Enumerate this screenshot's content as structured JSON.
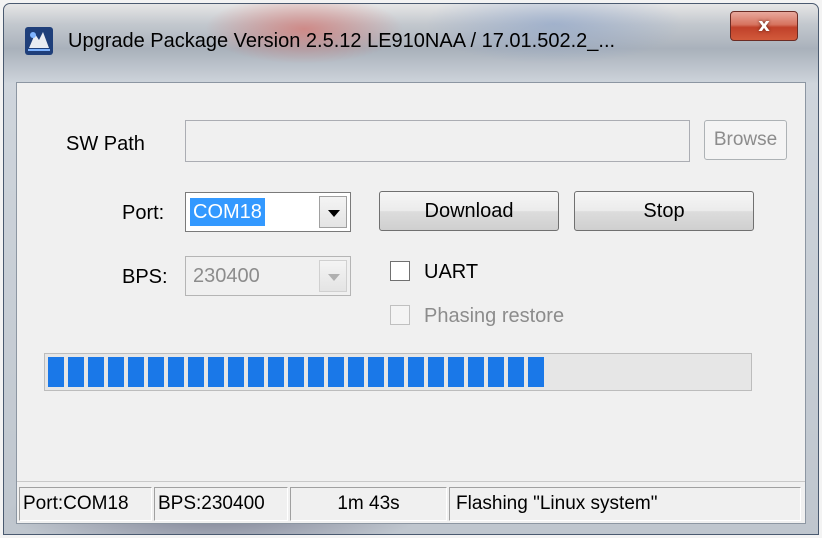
{
  "window": {
    "title": "Upgrade Package Version 2.5.12  LE910NAA / 17.01.502.2_...",
    "close_label": "x"
  },
  "form": {
    "sw_path_label": "SW Path",
    "sw_path_value": "",
    "browse_label": "Browse",
    "port_label": "Port:",
    "port_value": "COM18",
    "download_label": "Download",
    "stop_label": "Stop",
    "bps_label": "BPS:",
    "bps_value": "230400",
    "uart_label": "UART",
    "uart_checked": false,
    "phasing_label": "Phasing restore",
    "phasing_checked": false,
    "phasing_enabled": false
  },
  "progress": {
    "percent": 72
  },
  "statusbar": {
    "port": "Port:COM18",
    "bps": "BPS:230400",
    "elapsed": "1m 43s",
    "message": "Flashing \"Linux system\""
  },
  "colors": {
    "accent": "#1a78e8",
    "selection": "#3399ff",
    "close_button": "#c0412a"
  }
}
